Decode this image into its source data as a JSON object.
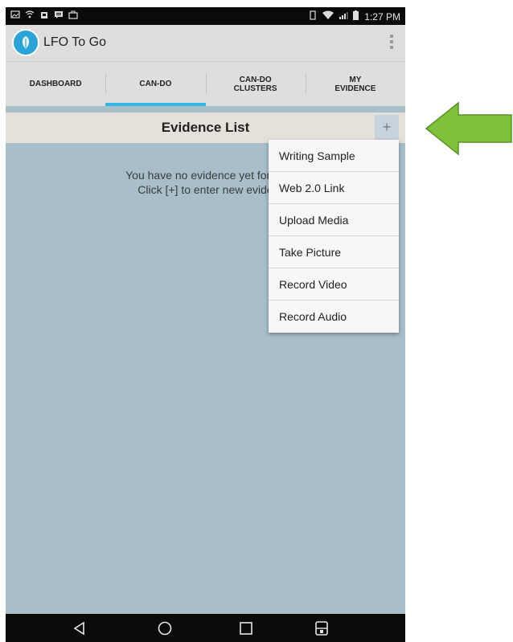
{
  "status_bar": {
    "time": "1:27 PM"
  },
  "app": {
    "title": "LFO To Go"
  },
  "tabs": [
    {
      "label": "DASHBOARD",
      "active": false
    },
    {
      "label": "CAN-DO",
      "active": true
    },
    {
      "label": "CAN-DO CLUSTERS",
      "active": false
    },
    {
      "label": "MY EVIDENCE",
      "active": false
    }
  ],
  "evidence": {
    "title": "Evidence List",
    "add_label": "+",
    "empty_line1": "You have no evidence yet for thi",
    "empty_line2": "Click [+] to enter new evide"
  },
  "menu": {
    "items": [
      "Writing Sample",
      "Web 2.0 Link",
      "Upload Media",
      "Take Picture",
      "Record Video",
      "Record Audio"
    ]
  },
  "colors": {
    "background": "#a8bfca",
    "accent": "#33b5e5",
    "arrow": "#7fc23a"
  }
}
